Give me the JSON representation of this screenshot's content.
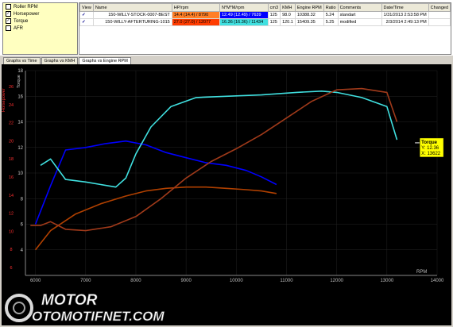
{
  "series_panel": {
    "items": [
      {
        "label": "Roller RPM",
        "checked": false
      },
      {
        "label": "Horsepower",
        "checked": true
      },
      {
        "label": "Torque",
        "checked": true
      },
      {
        "label": "AFR",
        "checked": false
      }
    ]
  },
  "runs_table": {
    "headers": [
      "View",
      "Name",
      "HP/rpm",
      "N*M*M/rpm",
      "cm3",
      "KMH",
      "Engine RPM",
      "Ratio",
      "Comments",
      "Date/Time",
      "Changed"
    ],
    "rows": [
      {
        "check": "✓",
        "name": "150-WILLY-STOCK-0007-BEST",
        "hp": "14.4 (14.4) / 8790",
        "nm": "12.49 (12.49) / 7639",
        "cm3": "125",
        "kmh": "98.0",
        "engine_rpm": "10388.32",
        "ratio": "5.24",
        "comments": "standart",
        "datetime": "1/31/2013 2:53:58 PM",
        "changed": "",
        "hp_color": "#ff7f27",
        "nm_color": "#0000ff"
      },
      {
        "check": "✓",
        "name": "150-WILLY-AFTERTURING-1015",
        "hp": "27.0 (27.0) / 12077",
        "nm": "16.36 (16.36) / 11434",
        "cm3": "125",
        "kmh": "120.1",
        "engine_rpm": "15409.35",
        "ratio": "5.25",
        "comments": "modified",
        "datetime": "2/3/2014 2:49:13 PM",
        "changed": "",
        "hp_color": "#ff3c00",
        "nm_color": "#40e0e0"
      }
    ]
  },
  "tabs": [
    {
      "label": "Graphs vs Time",
      "active": false
    },
    {
      "label": "Graphs vs KMH",
      "active": false
    },
    {
      "label": "Graphs vs Engine RPM",
      "active": true
    }
  ],
  "chart_data": {
    "type": "line",
    "xlabel": "RPM",
    "ylabel_left": "Horsepower",
    "ylabel_right": "Torque",
    "xlim": [
      5800,
      14000
    ],
    "x_ticks": [
      6000,
      7000,
      8000,
      9000,
      10000,
      11000,
      12000,
      13000,
      14000
    ],
    "ylim": [
      2,
      18
    ],
    "y_ticks": [
      4,
      6,
      8,
      10,
      12,
      14,
      16,
      18
    ],
    "y_ticks_left": [
      6,
      8,
      10,
      12,
      14,
      16,
      18,
      20,
      22,
      24,
      26
    ],
    "cursor_label": {
      "title": "Torque",
      "y": "Y: 12.36",
      "x": "X: 13622"
    },
    "series": [
      {
        "name": "150-WILLY-STOCK-0007-BEST Torque",
        "color": "#0000ff",
        "x": [
          6000,
          6300,
          6600,
          7000,
          7400,
          7800,
          8200,
          8600,
          9000,
          9400,
          9800,
          10200,
          10500,
          10800
        ],
        "y": [
          6,
          9,
          11.8,
          12,
          12.3,
          12.5,
          12.2,
          11.6,
          11.2,
          10.8,
          10.6,
          10.2,
          9.7,
          9.1
        ]
      },
      {
        "name": "150-WILLY-STOCK-0007-BEST Horsepower",
        "color": "#b04000",
        "x": [
          6000,
          6300,
          6800,
          7300,
          7800,
          8200,
          8600,
          9000,
          9400,
          9800,
          10200,
          10500,
          10800
        ],
        "y": [
          4,
          5.5,
          6.8,
          7.6,
          8.2,
          8.6,
          8.8,
          8.9,
          8.9,
          8.8,
          8.7,
          8.6,
          8.4
        ]
      },
      {
        "name": "150-WILLY-AFTERTURING-1015 Torque",
        "color": "#40e0e0",
        "x": [
          6100,
          6300,
          6600,
          7000,
          7300,
          7600,
          7800,
          8000,
          8300,
          8700,
          9200,
          9800,
          10500,
          11200,
          11700,
          12000,
          12500,
          13000,
          13200
        ],
        "y": [
          10.6,
          11.1,
          9.5,
          9.3,
          9.1,
          8.9,
          9.6,
          11.5,
          13.6,
          15.2,
          15.9,
          16,
          16.1,
          16.3,
          16.4,
          16.3,
          15.9,
          15.2,
          12.6
        ]
      },
      {
        "name": "150-WILLY-AFTERTURING-1015 Horsepower",
        "color": "#a03a1a",
        "x": [
          5900,
          6100,
          6300,
          6600,
          7000,
          7500,
          8000,
          8500,
          9000,
          9500,
          10000,
          10500,
          11000,
          11500,
          12000,
          12500,
          13000,
          13200
        ],
        "y": [
          5.9,
          5.9,
          6.2,
          5.6,
          5.5,
          5.8,
          6.6,
          8,
          9.6,
          10.9,
          11.9,
          13,
          14.3,
          15.6,
          16.5,
          16.6,
          16.3,
          14
        ]
      }
    ]
  },
  "watermark": {
    "line1": "MOTOR",
    "line2": "OTOMOTIFNET.COM",
    "color": "#ffffff"
  }
}
